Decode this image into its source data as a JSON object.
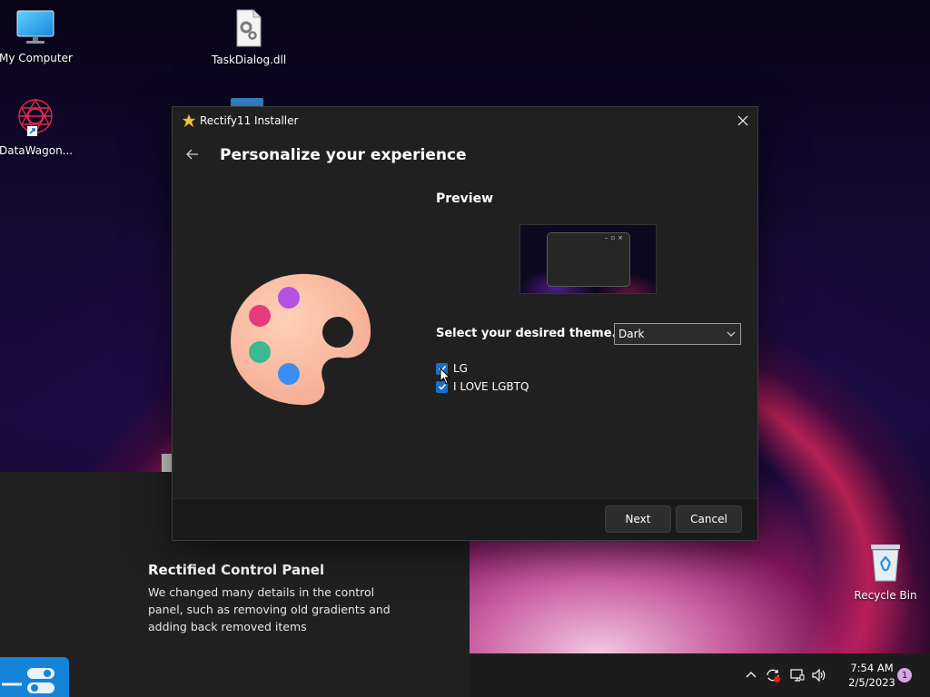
{
  "desktop": {
    "icons": [
      {
        "label": "My Computer",
        "icon": "monitor-icon"
      },
      {
        "label": "TaskDialog.dll",
        "icon": "dll-file-icon"
      },
      {
        "label": "DataWagon...",
        "icon": "datawagon-shortcut-icon"
      },
      {
        "label": "Recycle Bin",
        "icon": "recycle-bin-icon"
      }
    ]
  },
  "info_panel": {
    "title": "Rectified Control Panel",
    "description": "We changed many details in the control panel, such as removing old gradients and adding back removed items"
  },
  "installer": {
    "window_title": "Rectify11 Installer",
    "page_title": "Personalize your experience",
    "preview_label": "Preview",
    "theme_label": "Select your desired theme.",
    "theme_selected": "Dark",
    "options": [
      {
        "label": "LG",
        "checked": true
      },
      {
        "label": "I LOVE LGBTQ",
        "checked": true
      }
    ],
    "buttons": {
      "next": "Next",
      "cancel": "Cancel"
    }
  },
  "taskbar": {
    "time": "7:54 AM",
    "date": "2/5/2023",
    "notification_count": "1"
  },
  "colors": {
    "accent": "#1b6fc2",
    "window_bg": "#202020",
    "taskbar_bg": "#1c1c1c"
  }
}
